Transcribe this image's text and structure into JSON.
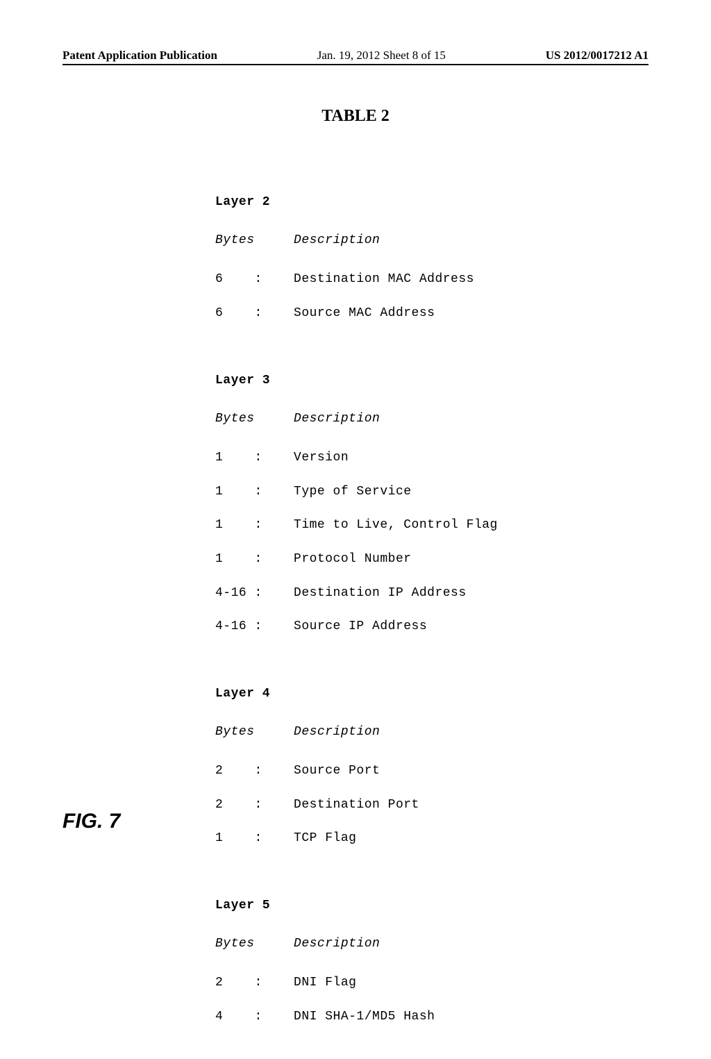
{
  "header": {
    "left": "Patent Application Publication",
    "mid": "Jan. 19, 2012  Sheet 8 of 15",
    "right": "US 2012/0017212 A1"
  },
  "table_title": "TABLE 2",
  "fig_label": "FIG. 7",
  "sections": {
    "layer2": {
      "heading": "Layer 2",
      "col_bytes": "Bytes",
      "col_desc": "Description",
      "r0": "6    :    Destination MAC Address",
      "r1": "6    :    Source MAC Address"
    },
    "layer3": {
      "heading": "Layer 3",
      "col_bytes": "Bytes",
      "col_desc": "Description",
      "r0": "1    :    Version",
      "r1": "1    :    Type of Service",
      "r2": "1    :    Time to Live, Control Flag",
      "r3": "1    :    Protocol Number",
      "r4": "4-16 :    Destination IP Address",
      "r5": "4-16 :    Source IP Address"
    },
    "layer4": {
      "heading": "Layer 4",
      "col_bytes": "Bytes",
      "col_desc": "Description",
      "r0": "2    :    Source Port",
      "r1": "2    :    Destination Port",
      "r2": "1    :    TCP Flag"
    },
    "layer5": {
      "heading": "Layer 5",
      "col_bytes": "Bytes",
      "col_desc": "Description",
      "r0": "2    :    DNI Flag",
      "r1": "4    :    DNI SHA-1/MD5 Hash"
    }
  },
  "chart_data": {
    "type": "table",
    "title": "TABLE 2",
    "layers": [
      {
        "name": "Layer 2",
        "columns": [
          "Bytes",
          "Description"
        ],
        "rows": [
          {
            "bytes": "6",
            "description": "Destination MAC Address"
          },
          {
            "bytes": "6",
            "description": "Source MAC Address"
          }
        ]
      },
      {
        "name": "Layer 3",
        "columns": [
          "Bytes",
          "Description"
        ],
        "rows": [
          {
            "bytes": "1",
            "description": "Version"
          },
          {
            "bytes": "1",
            "description": "Type of Service"
          },
          {
            "bytes": "1",
            "description": "Time to Live, Control Flag"
          },
          {
            "bytes": "1",
            "description": "Protocol Number"
          },
          {
            "bytes": "4-16",
            "description": "Destination IP Address"
          },
          {
            "bytes": "4-16",
            "description": "Source IP Address"
          }
        ]
      },
      {
        "name": "Layer 4",
        "columns": [
          "Bytes",
          "Description"
        ],
        "rows": [
          {
            "bytes": "2",
            "description": "Source Port"
          },
          {
            "bytes": "2",
            "description": "Destination Port"
          },
          {
            "bytes": "1",
            "description": "TCP Flag"
          }
        ]
      },
      {
        "name": "Layer 5",
        "columns": [
          "Bytes",
          "Description"
        ],
        "rows": [
          {
            "bytes": "2",
            "description": "DNI Flag"
          },
          {
            "bytes": "4",
            "description": "DNI SHA-1/MD5 Hash"
          }
        ]
      }
    ]
  }
}
